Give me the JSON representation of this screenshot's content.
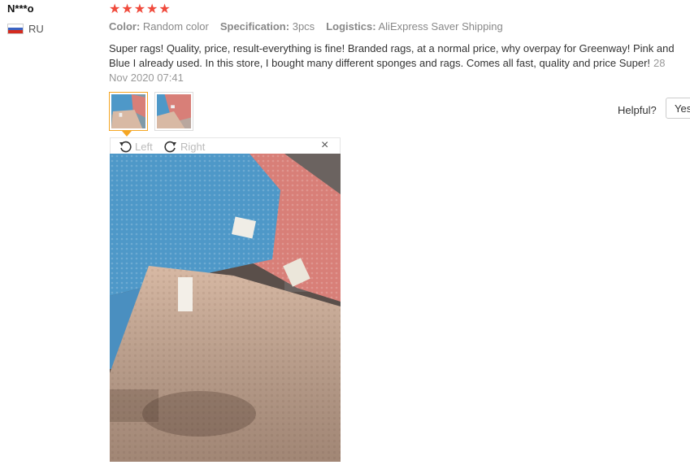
{
  "reviewer": {
    "name": "N***o",
    "country": "RU"
  },
  "rating": {
    "stars": 5
  },
  "properties": {
    "color_label": "Color:",
    "color_value": "Random color",
    "spec_label": "Specification:",
    "spec_value": "3pcs",
    "logistics_label": "Logistics:",
    "logistics_value": "AliExpress Saver Shipping"
  },
  "review": {
    "text": "Super rags! Quality, price, result-everything is fine! Branded rags, at a normal price, why overpay for Greenway! Pink and Blue I already used. In this store, I bought many different sponges and rags. Comes all fast, quality and price Super!",
    "date": "28 Nov 2020 07:41"
  },
  "helpful": {
    "label": "Helpful?",
    "yes_label": "Yes"
  },
  "viewer": {
    "left_label": "Left",
    "right_label": "Right",
    "close_symbol": "×"
  },
  "icons": {
    "rotate_left": "rotate-left-icon",
    "rotate_right": "rotate-right-icon",
    "close": "close-icon",
    "star": "star-icon",
    "flag": "russia-flag-icon"
  },
  "colors": {
    "star": "#f04a3c",
    "active_thumb": "#f5a623",
    "blue_rag": "#4e98c8",
    "pink_rag": "#d87f78",
    "beige_rag": "#d8b9a4"
  }
}
